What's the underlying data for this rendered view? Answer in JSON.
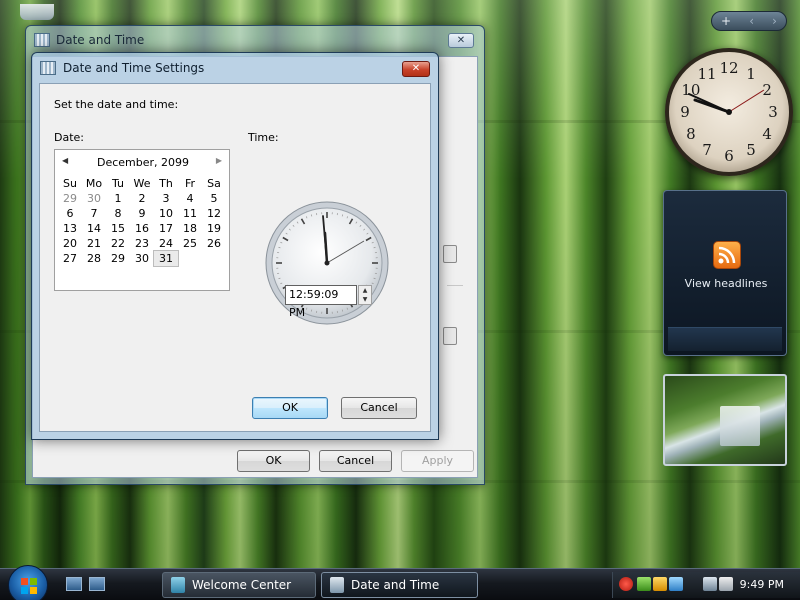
{
  "desktop": {
    "gadget_toolbar": {
      "add": "+",
      "prev": "‹",
      "next": "›"
    },
    "feed_gadget": {
      "label": "View headlines"
    }
  },
  "outer_window": {
    "title": "Date and Time",
    "close_glyph": "✕",
    "buttons": {
      "ok": "OK",
      "cancel": "Cancel",
      "apply": "Apply"
    }
  },
  "dialog": {
    "title": "Date and Time Settings",
    "close_glyph": "✕",
    "heading": "Set the date and time:",
    "date_label": "Date:",
    "time_label": "Time:",
    "calendar": {
      "month": "December, 2099",
      "prev": "◀",
      "next": "▶",
      "weekdays": [
        "Su",
        "Mo",
        "Tu",
        "We",
        "Th",
        "Fr",
        "Sa"
      ],
      "weeks": [
        [
          "29",
          "30",
          "1",
          "2",
          "3",
          "4",
          "5"
        ],
        [
          "6",
          "7",
          "8",
          "9",
          "10",
          "11",
          "12"
        ],
        [
          "13",
          "14",
          "15",
          "16",
          "17",
          "18",
          "19"
        ],
        [
          "20",
          "21",
          "22",
          "23",
          "24",
          "25",
          "26"
        ],
        [
          "27",
          "28",
          "29",
          "30",
          "31",
          "",
          ""
        ]
      ],
      "selected": "31"
    },
    "time_value": "12:59:09 PM",
    "spin_up": "▲",
    "spin_down": "▼",
    "buttons": {
      "ok": "OK",
      "cancel": "Cancel"
    }
  },
  "taskbar": {
    "tasks": [
      {
        "label": "Welcome Center",
        "active": false
      },
      {
        "label": "Date and Time",
        "active": true
      }
    ],
    "clock": "9:49 PM"
  },
  "colors": {
    "accent": "#3c7fb1",
    "close_red": "#c8422a"
  }
}
